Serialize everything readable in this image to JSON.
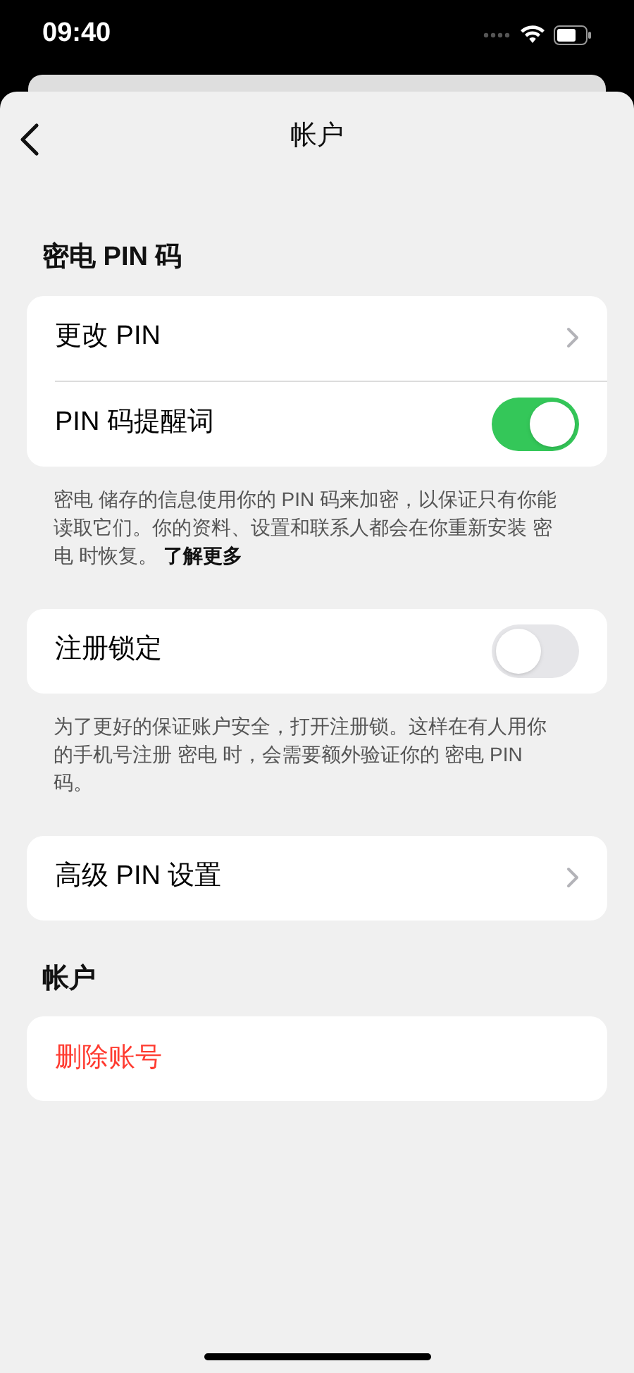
{
  "status_bar": {
    "time": "09:40"
  },
  "nav": {
    "title": "帐户"
  },
  "sections": [
    {
      "header": "密电 PIN 码",
      "rows": [
        {
          "kind": "chevron",
          "label": "更改 PIN"
        },
        {
          "kind": "toggle",
          "label": "PIN 码提醒词",
          "on": true
        }
      ],
      "footer": {
        "text": "密电 储存的信息使用你的 PIN 码来加密，以保证只有你能读取它们。你的资料、设置和联系人都会在你重新安装 密电 时恢复。",
        "link": "了解更多"
      }
    },
    {
      "rows": [
        {
          "kind": "toggle",
          "label": "注册锁定",
          "on": false
        }
      ],
      "footer": {
        "text": "为了更好的保证账户安全，打开注册锁。这样在有人用你的手机号注册 密电 时，会需要额外验证你的 密电 PIN 码。"
      }
    },
    {
      "rows": [
        {
          "kind": "chevron",
          "label": "高级 PIN 设置"
        }
      ]
    },
    {
      "header": "帐户",
      "rows": [
        {
          "kind": "destructive",
          "label": "删除账号"
        }
      ]
    }
  ]
}
